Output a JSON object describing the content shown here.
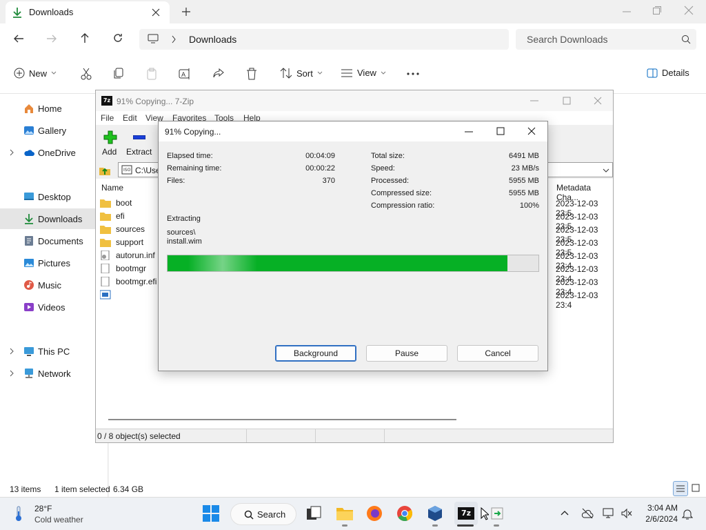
{
  "explorer": {
    "tab_title": "Downloads",
    "breadcrumb": "Downloads",
    "search_placeholder": "Search Downloads",
    "toolbar": {
      "new": "New",
      "sort": "Sort",
      "view": "View",
      "details": "Details"
    },
    "nav": [
      "Home",
      "Gallery",
      "OneDrive",
      "Desktop",
      "Downloads",
      "Documents",
      "Pictures",
      "Music",
      "Videos",
      "This PC",
      "Network"
    ],
    "status_items": "13 items",
    "status_selected": "1 item selected",
    "status_size": "6.34 GB"
  },
  "zip_manager": {
    "title": "91% Copying... 7-Zip",
    "menu": [
      "File",
      "Edit",
      "View",
      "Favorites",
      "Tools",
      "Help"
    ],
    "toolbar": {
      "add": "Add",
      "extract": "Extract"
    },
    "path": "C:\\Use",
    "col_name": "Name",
    "col_metadata": "Metadata Cha...",
    "files": [
      "boot",
      "efi",
      "sources",
      "support",
      "autorun.inf",
      "bootmgr",
      "bootmgr.efi",
      ""
    ],
    "metadata": [
      "2023-12-03 23:5",
      "2023-12-03 23:5",
      "2023-12-03 23:5",
      "2023-12-03 23:5",
      "2023-12-03 23:4",
      "2023-12-03 23:4",
      "2023-12-03 23:4",
      "2023-12-03 23:4"
    ],
    "status": "0 / 8 object(s) selected"
  },
  "progress": {
    "title": "91% Copying...",
    "elapsed_label": "Elapsed time:",
    "elapsed": "00:04:09",
    "remaining_label": "Remaining time:",
    "remaining": "00:00:22",
    "files_label": "Files:",
    "files": "370",
    "total_label": "Total size:",
    "total": "6491 MB",
    "speed_label": "Speed:",
    "speed": "23 MB/s",
    "processed_label": "Processed:",
    "processed": "5955 MB",
    "compressed_label": "Compressed size:",
    "compressed": "5955 MB",
    "ratio_label": "Compression ratio:",
    "ratio": "100%",
    "action": "Extracting",
    "path_line1": "sources\\",
    "path_line2": "install.wim",
    "percent": 91.7,
    "buttons": {
      "background": "Background",
      "pause": "Pause",
      "cancel": "Cancel"
    }
  },
  "taskbar": {
    "weather_temp": "28°F",
    "weather_desc": "Cold weather",
    "search": "Search",
    "time": "3:04 AM",
    "date": "2/6/2024"
  },
  "colors": {
    "progress_green": "#06b025",
    "accent_blue": "#0067c0"
  }
}
